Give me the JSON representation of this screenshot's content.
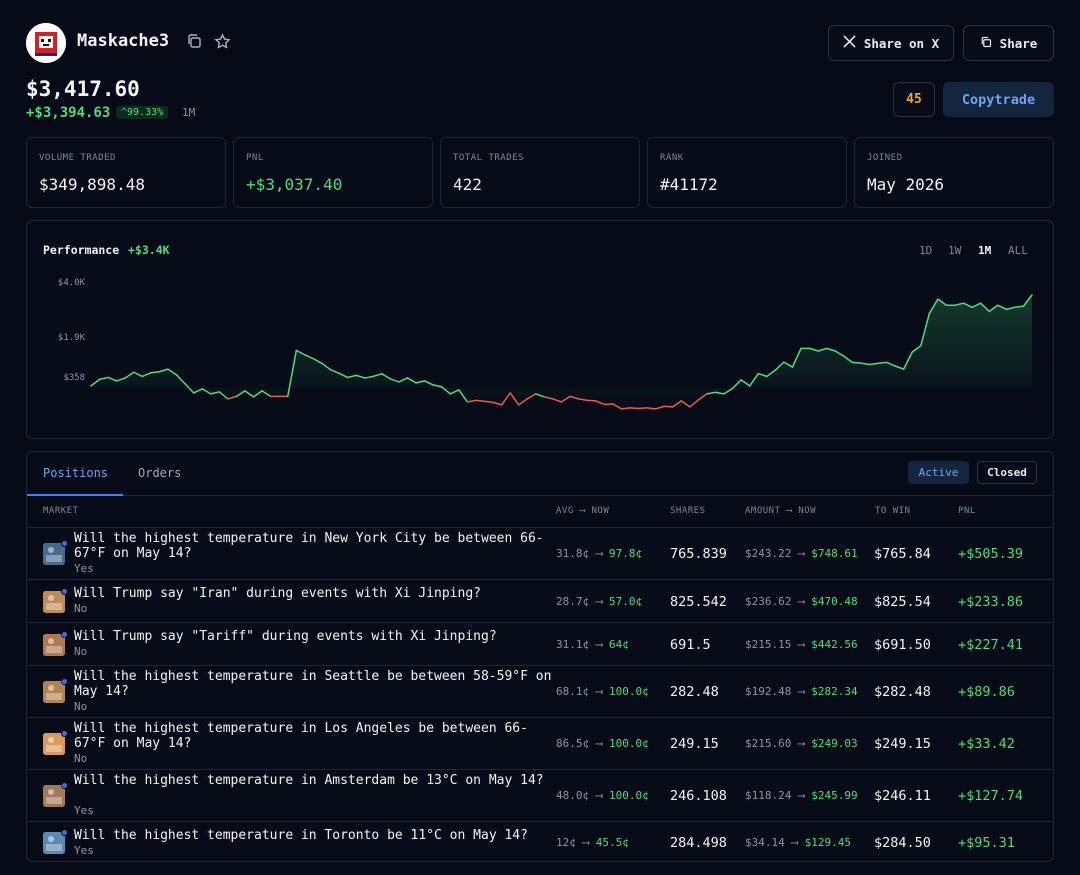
{
  "profile": {
    "username": "Maskache3",
    "portfolio_value": "$3,417.60",
    "gain": "+$3,394.63",
    "gain_pct": "^99.33%",
    "period": "1M",
    "score": "45"
  },
  "actions": {
    "share_on_x": "Share on X",
    "share": "Share",
    "copytrade": "Copytrade"
  },
  "stats": [
    {
      "label": "VOLUME TRADED",
      "value": "$349,898.48",
      "color": "#f2f4f8"
    },
    {
      "label": "PNL",
      "value": "+$3,037.40",
      "color": "#4ade80"
    },
    {
      "label": "TOTAL TRADES",
      "value": "422",
      "color": "#f2f4f8"
    },
    {
      "label": "RANK",
      "value": "#41172",
      "color": "#f2f4f8"
    },
    {
      "label": "JOINED",
      "value": "May 2026",
      "color": "#f2f4f8"
    }
  ],
  "performance": {
    "label": "Performance",
    "value": "+$3.4K",
    "ranges": [
      "1D",
      "1W",
      "1M",
      "ALL"
    ],
    "active_range": "1M"
  },
  "chart_data": {
    "type": "line",
    "y_ticks": [
      "$4.0K",
      "$1.9K",
      "$358"
    ],
    "y_tick_values": [
      4000,
      1900,
      358
    ],
    "positive_color": "#4ade80",
    "negative_color": "#ef5a4a",
    "values": [
      200,
      330,
      380,
      300,
      360,
      580,
      420,
      560,
      600,
      700,
      480,
      240,
      60,
      140,
      40,
      80,
      -60,
      -10,
      100,
      -20,
      100,
      -10,
      -10,
      -10,
      1420,
      1250,
      1100,
      920,
      680,
      540,
      380,
      460,
      360,
      420,
      520,
      340,
      280,
      360,
      260,
      300,
      220,
      180,
      40,
      120,
      -120,
      -90,
      -110,
      -130,
      -180,
      60,
      -180,
      -60,
      40,
      -20,
      -60,
      -120,
      -10,
      -60,
      -90,
      -100,
      -170,
      -160,
      -260,
      -240,
      -250,
      -240,
      -260,
      -210,
      -220,
      -100,
      -220,
      -80,
      40,
      70,
      40,
      150,
      320,
      200,
      530,
      420,
      660,
      970,
      780,
      1500,
      1500,
      1400,
      1500,
      1400,
      1200,
      960,
      930,
      880,
      920,
      960,
      820,
      700,
      1360,
      1600,
      3100,
      3800,
      3500,
      3500,
      3600,
      3400,
      3600,
      3200,
      3500,
      3300,
      3400,
      3450,
      4000
    ]
  },
  "tabs": {
    "positions": "Positions",
    "orders": "Orders",
    "active": "Active",
    "closed": "Closed"
  },
  "table": {
    "headers": {
      "market": "MARKET",
      "avg_now": "AVG ⟶ NOW",
      "shares": "SHARES",
      "amount_now": "AMOUNT ⟶ NOW",
      "to_win": "TO WIN",
      "pnl": "PNL"
    },
    "arrow": "⟶",
    "rows": [
      {
        "question": "Will the highest temperature in New York City be between 66-67°F on May 14?",
        "side": "Yes",
        "avg": "31.8¢",
        "now": "97.8¢",
        "shares": "765.839",
        "amount": "$243.22",
        "amount_now": "$748.61",
        "to_win": "$765.84",
        "pnl": "+$505.39",
        "thumb": "#4a6a8a"
      },
      {
        "question": "Will Trump say \"Iran\" during events with Xi Jinping?",
        "side": "No",
        "avg": "28.7¢",
        "now": "57.0¢",
        "shares": "825.542",
        "amount": "$236.62",
        "amount_now": "$470.48",
        "to_win": "$825.54",
        "pnl": "+$233.86",
        "thumb": "#c08a5a"
      },
      {
        "question": "Will Trump say \"Tariff\" during events with Xi Jinping?",
        "side": "No",
        "avg": "31.1¢",
        "now": "64¢",
        "shares": "691.5",
        "amount": "$215.15",
        "amount_now": "$442.56",
        "to_win": "$691.50",
        "pnl": "+$227.41",
        "thumb": "#b07a50"
      },
      {
        "question": "Will the highest temperature in Seattle be between 58-59°F on May 14?",
        "side": "No",
        "avg": "68.1¢",
        "now": "100.0¢",
        "shares": "282.48",
        "amount": "$192.48",
        "amount_now": "$282.34",
        "to_win": "$282.48",
        "pnl": "+$89.86",
        "thumb": "#b08450"
      },
      {
        "question": "Will the highest temperature in Los Angeles be between 66-67°F on May 14?",
        "side": "No",
        "avg": "86.5¢",
        "now": "100.0¢",
        "shares": "249.15",
        "amount": "$215.60",
        "amount_now": "$249.03",
        "to_win": "$249.15",
        "pnl": "+$33.42",
        "thumb": "#d89a58"
      },
      {
        "question": "Will the highest temperature in Amsterdam be 13°C on May 14?",
        "side": "Yes",
        "avg": "48.0¢",
        "now": "100.0¢",
        "shares": "246.108",
        "amount": "$118.24",
        "amount_now": "$245.99",
        "to_win": "$246.11",
        "pnl": "+$127.74",
        "thumb": "#a07a5a"
      },
      {
        "question": "Will the highest temperature in Toronto be 11°C on May 14?",
        "side": "Yes",
        "avg": "12¢",
        "now": "45.5¢",
        "shares": "284.498",
        "amount": "$34.14",
        "amount_now": "$129.45",
        "to_win": "$284.50",
        "pnl": "+$95.31",
        "thumb": "#5a8ab0"
      }
    ]
  }
}
